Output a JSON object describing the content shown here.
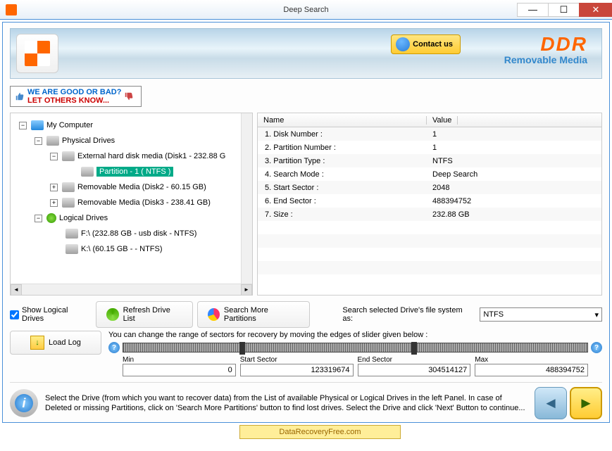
{
  "window": {
    "title": "Deep Search"
  },
  "banner": {
    "contact_label": "Contact us",
    "brand": "DDR",
    "brand_sub": "Removable Media"
  },
  "survey": {
    "line1": "WE ARE GOOD OR BAD?",
    "line2": "LET OTHERS KNOW..."
  },
  "tree": {
    "root": "My Computer",
    "physical": "Physical Drives",
    "ext_disk": "External hard disk media (Disk1 - 232.88 G",
    "partition1": "Partition - 1 ( NTFS )",
    "removable2": "Removable Media (Disk2 - 60.15 GB)",
    "removable3": "Removable Media (Disk3 - 238.41 GB)",
    "logical": "Logical Drives",
    "drive_f": "F:\\ (232.88 GB - usb disk - NTFS)",
    "drive_k": "K:\\ (60.15 GB -  - NTFS)"
  },
  "props": {
    "header_name": "Name",
    "header_value": "Value",
    "rows": [
      {
        "name": "1. Disk Number :",
        "value": "1"
      },
      {
        "name": "2. Partition Number :",
        "value": "1"
      },
      {
        "name": "3. Partition Type :",
        "value": "NTFS"
      },
      {
        "name": "4. Search Mode :",
        "value": "Deep Search"
      },
      {
        "name": "5. Start Sector :",
        "value": "2048"
      },
      {
        "name": "6. End Sector :",
        "value": "488394752"
      },
      {
        "name": "7. Size :",
        "value": "232.88 GB"
      }
    ]
  },
  "opts": {
    "show_logical": "Show Logical Drives",
    "refresh": "Refresh Drive List",
    "search_more": "Search More Partitions",
    "fs_label": "Search selected Drive's file system as:",
    "fs_value": "NTFS"
  },
  "slider": {
    "load_log": "Load Log",
    "desc": "You can change the range of sectors for recovery by moving the edges of slider given below :",
    "min_label": "Min",
    "min_val": "0",
    "start_label": "Start Sector",
    "start_val": "123319674",
    "end_label": "End Sector",
    "end_val": "304514127",
    "max_label": "Max",
    "max_val": "488394752"
  },
  "footer": {
    "text": "Select the Drive (from which you want to recover data) from the List of available Physical or Logical Drives in the left Panel. In case of Deleted or missing Partitions, click on 'Search More Partitions' button to find lost drives. Select the Drive and click 'Next' Button to continue..."
  },
  "url": "DataRecoveryFree.com"
}
